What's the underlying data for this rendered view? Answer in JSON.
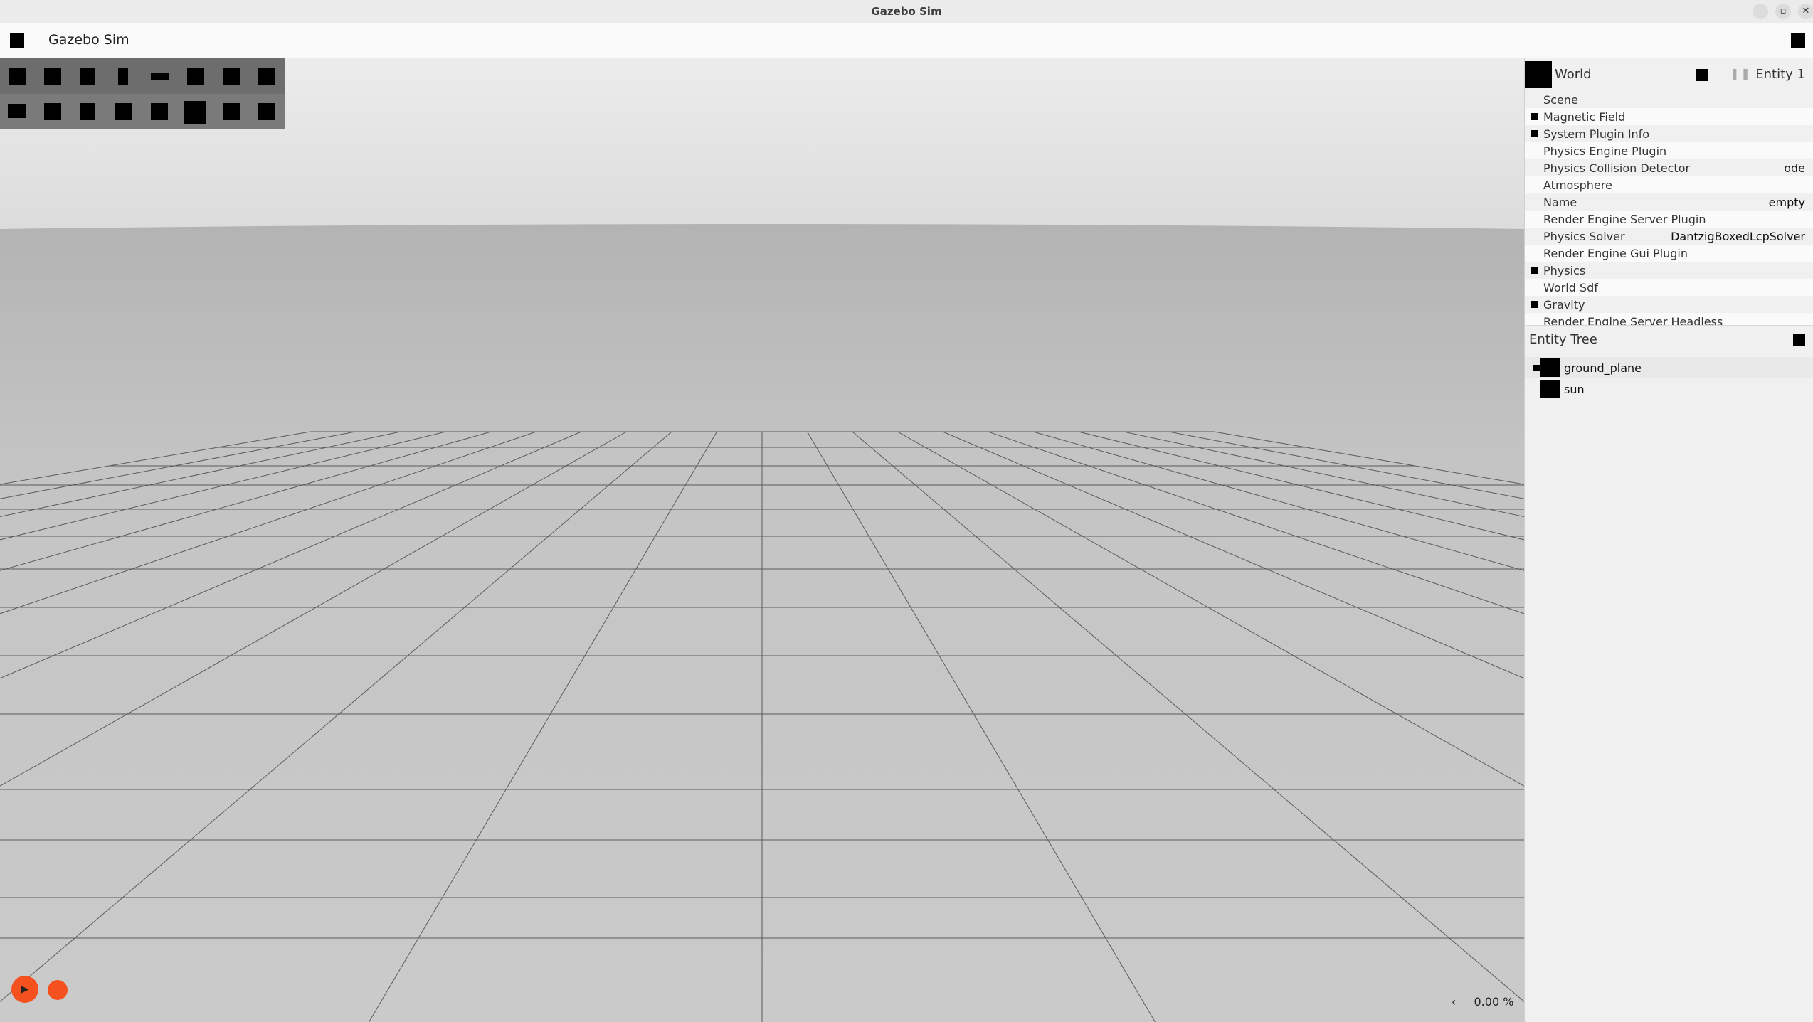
{
  "window": {
    "title": "Gazebo Sim",
    "controls": [
      "minimize-icon",
      "maximize-icon",
      "close-icon"
    ],
    "minimize_glyph": "–",
    "maximize_glyph": "▫",
    "close_glyph": "✕"
  },
  "toolbar": {
    "title": "Gazebo Sim",
    "left_icon": "menu-icon",
    "right_icon": "plugin-menu-icon"
  },
  "tools": {
    "row1": [
      "select-icon",
      "translate-icon",
      "rotate-icon",
      "box-icon",
      "view-angle-icon",
      "sphere-icon",
      "cylinder-icon",
      "capsule-icon"
    ],
    "row2": [
      "ellipsoid-icon",
      "directional-light-icon",
      "point-light-icon",
      "spot-light-icon",
      "mesh-icon",
      "camera-view-icon",
      "grid-icon",
      "screenshot-icon"
    ]
  },
  "component_inspector": {
    "entity_name": "World",
    "entity_id": "Entity 1",
    "pause_glyph": "❚❚",
    "components": [
      {
        "name": "Scene",
        "value": "",
        "expandable": false
      },
      {
        "name": "Magnetic Field",
        "value": "",
        "expandable": true
      },
      {
        "name": "System Plugin Info",
        "value": "",
        "expandable": true
      },
      {
        "name": "Physics Engine Plugin",
        "value": "",
        "expandable": false
      },
      {
        "name": "Physics Collision Detector",
        "value": "ode",
        "expandable": false
      },
      {
        "name": "Atmosphere",
        "value": "",
        "expandable": false
      },
      {
        "name": "Name",
        "value": "empty",
        "expandable": false
      },
      {
        "name": "Render Engine Server Plugin",
        "value": "",
        "expandable": false
      },
      {
        "name": "Physics Solver",
        "value": "DantzigBoxedLcpSolver",
        "expandable": false
      },
      {
        "name": "Render Engine Gui Plugin",
        "value": "",
        "expandable": false
      },
      {
        "name": "Physics",
        "value": "",
        "expandable": true
      },
      {
        "name": "World Sdf",
        "value": "",
        "expandable": false
      },
      {
        "name": "Gravity",
        "value": "",
        "expandable": true
      },
      {
        "name": "Render Engine Server Headless",
        "value": "",
        "expandable": false
      }
    ]
  },
  "entity_tree": {
    "title": "Entity Tree",
    "items": [
      {
        "name": "ground_plane",
        "expandable": true
      },
      {
        "name": "sun",
        "expandable": false
      }
    ]
  },
  "playback": {
    "play_glyph": "▶",
    "rtf_chevron": "‹",
    "real_time_factor": "0.00 %"
  },
  "colors": {
    "accent": "#f4511e",
    "sky": "#e6e6e6",
    "ground": "#c8c8c8"
  }
}
